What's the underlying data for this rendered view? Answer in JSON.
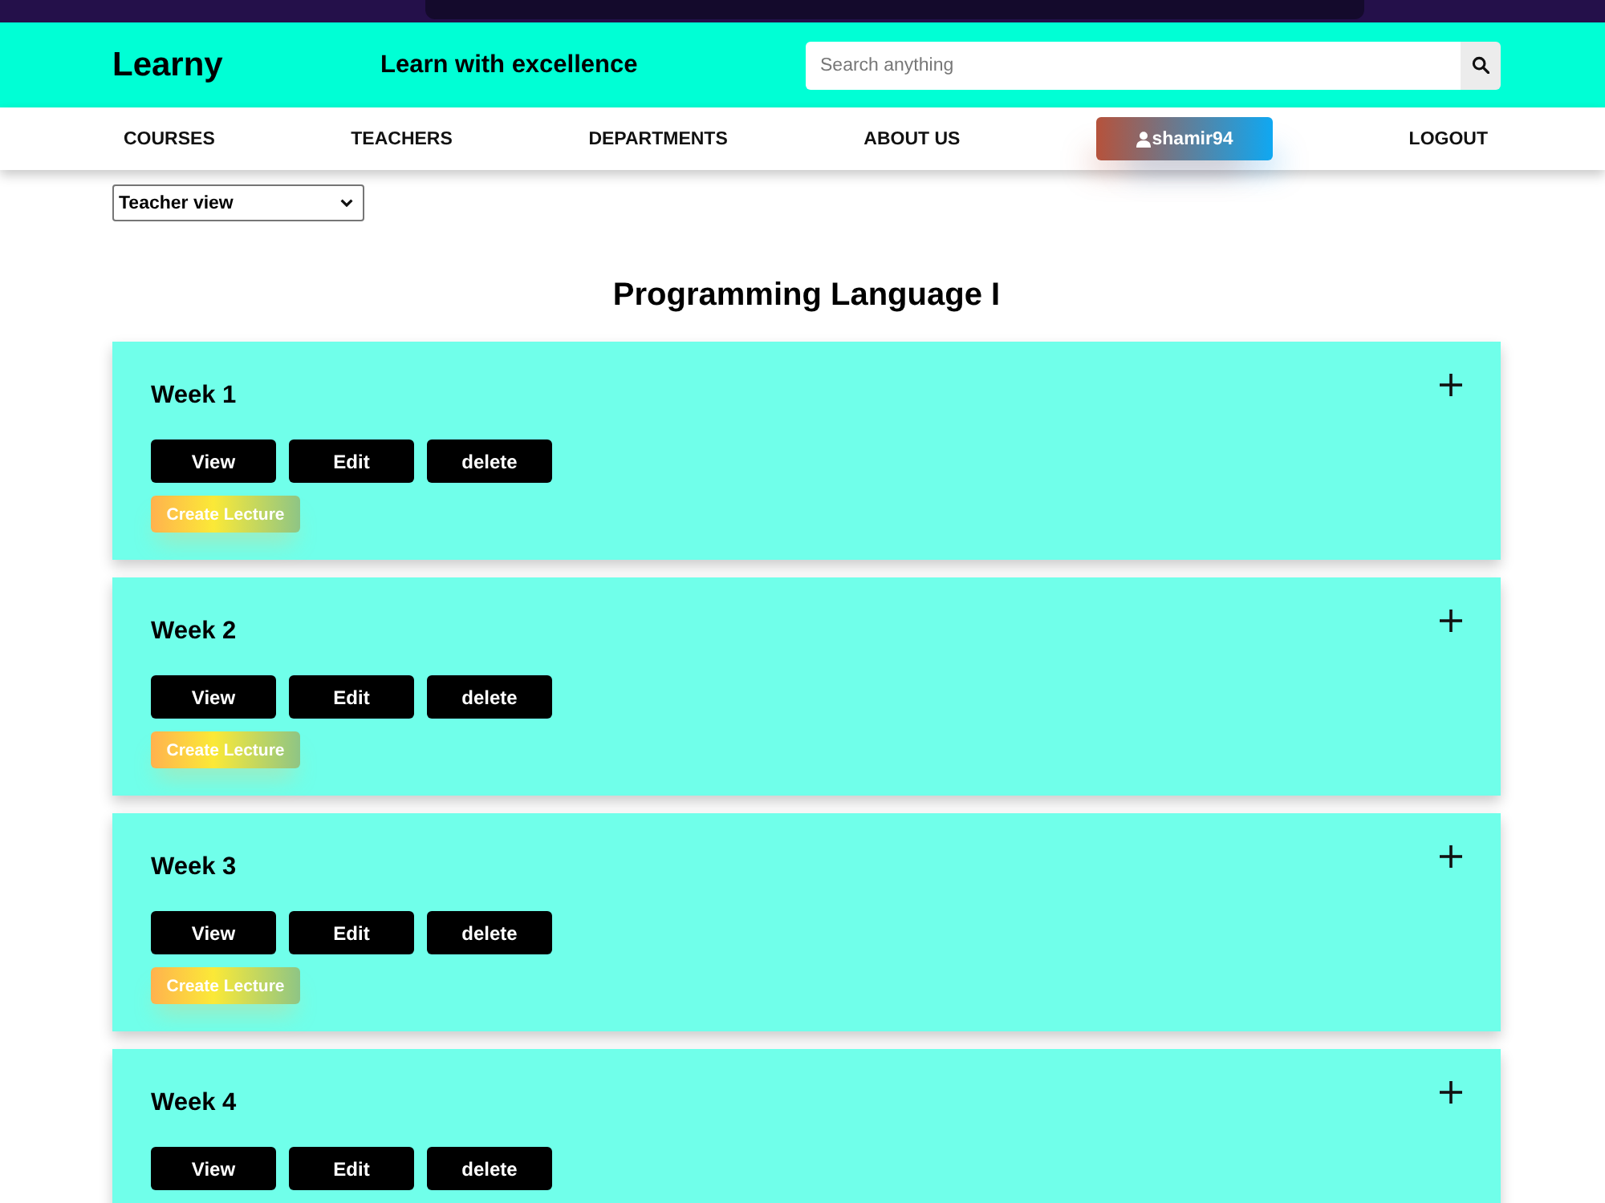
{
  "header": {
    "logo": "Learny",
    "tagline": "Learn with excellence",
    "search": {
      "placeholder": "Search anything"
    }
  },
  "nav": {
    "items": [
      {
        "label": "COURSES",
        "kind": "link"
      },
      {
        "label": "TEACHERS",
        "kind": "link"
      },
      {
        "label": "DEPARTMENTS",
        "kind": "link"
      },
      {
        "label": "ABOUT US",
        "kind": "link"
      },
      {
        "label": "shamir94",
        "kind": "user"
      },
      {
        "label": "LOGOUT",
        "kind": "link"
      }
    ]
  },
  "view_select": {
    "value": "Teacher view"
  },
  "course": {
    "title": "Programming Language I"
  },
  "weeks": [
    {
      "title": "Week 1",
      "expanded": false,
      "buttons": [
        "View",
        "Edit",
        "delete"
      ],
      "create_button": "Create Lecture"
    },
    {
      "title": "Week 2",
      "expanded": false,
      "buttons": [
        "View",
        "Edit",
        "delete"
      ],
      "create_button": "Create Lecture"
    },
    {
      "title": "Week 3",
      "expanded": false,
      "buttons": [
        "View",
        "Edit",
        "delete"
      ],
      "create_button": "Create Lecture"
    },
    {
      "title": "Week 4",
      "expanded": false,
      "buttons": [
        "View",
        "Edit",
        "delete"
      ]
    }
  ]
}
